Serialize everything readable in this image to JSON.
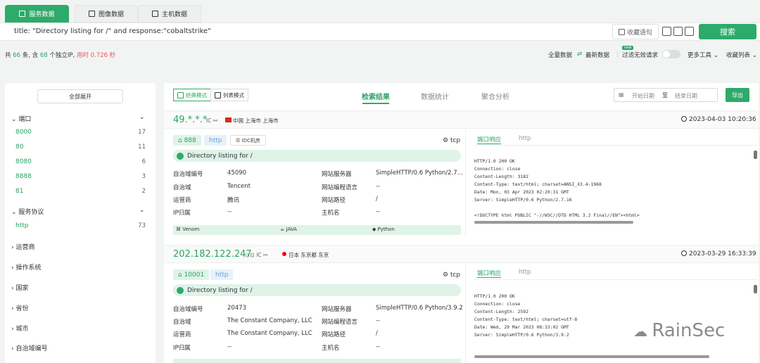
{
  "tabs": [
    {
      "label": "服务数据",
      "active": true
    },
    {
      "label": "图像数据",
      "active": false
    },
    {
      "label": "主机数据",
      "active": false
    }
  ],
  "search": {
    "query": "title: \"Directory listing for /\" and response:\"cobaltstrike\"",
    "collect_label": "收藏语句",
    "button_label": "搜索"
  },
  "stats": {
    "prefix": "共",
    "count": "66",
    "mid1": "条, 含",
    "ip_count": "68",
    "mid2": "个独立IP,",
    "time_label": "用时",
    "time": "0.726 秒"
  },
  "topright": {
    "all_data": "全量数据",
    "latest": "最新数据",
    "new_badge": "new",
    "filter": "过滤无效请求",
    "more_tools": "更多工具",
    "collect_list": "收藏列表"
  },
  "sidebar": {
    "expand_all": "全部展开",
    "groups": [
      {
        "label": "端口",
        "items": [
          {
            "name": "8000",
            "count": "17"
          },
          {
            "name": "80",
            "count": "11"
          },
          {
            "name": "8080",
            "count": "6"
          },
          {
            "name": "8888",
            "count": "3"
          },
          {
            "name": "81",
            "count": "2"
          }
        ]
      },
      {
        "label": "服务协议",
        "items": [
          {
            "name": "http",
            "count": "73"
          }
        ]
      },
      {
        "label": "运营商"
      },
      {
        "label": "操作系统"
      },
      {
        "label": "国家"
      },
      {
        "label": "省份"
      },
      {
        "label": "城市"
      },
      {
        "label": "自治域编号"
      }
    ]
  },
  "main": {
    "modes": [
      "经典模式",
      "列表模式"
    ],
    "tabs": [
      "检索结果",
      "数据统计",
      "聚合分析"
    ],
    "start_date": "开始日期",
    "date_sep": "至",
    "end_date": "结束日期",
    "export": "导出"
  },
  "results": [
    {
      "ip": "49.*.*.*",
      "meta": "IC ⚯",
      "location": "中国 上海市 上海市",
      "timestamp": "2023-04-03 10:20:36",
      "port": "888",
      "proto": "http",
      "extra_tag": "IDC机房",
      "transport": "tcp",
      "title": "Directory listing for /",
      "fields": [
        [
          "自治域编号",
          "45090",
          "网站服务器",
          "SimpleHTTP/0.6 Python/2.7..."
        ],
        [
          "自治域",
          "Tencent",
          "网站编程语言",
          "--"
        ],
        [
          "运营商",
          "腾讯",
          "网站路径",
          "/"
        ],
        [
          "IP归属",
          "--",
          "主机名",
          "--"
        ]
      ],
      "tech": [
        "Venom",
        "JAVA",
        "Python"
      ],
      "rtabs": [
        "端口响应",
        "http"
      ],
      "response": [
        "HTTP/1.0 200 OK",
        "Connection: close",
        "Content-Length: 3182",
        "Content-Type: text/html; charset=ANSI_X3.4-1968",
        "Date: Mon, 03 Apr 2023 02:20:31 GMT",
        "Server: SimpleHTTP/0.6 Python/2.7.16",
        "",
        "<!DOCTYPE html PUBLIC \"-//W3C//DTD HTML 3.2 Final//EN\"><html>"
      ]
    },
    {
      "ip": "202.182.122.247",
      "meta": "IC ⚯",
      "location": "日本 东京都 东京",
      "timestamp": "2023-03-29 16:33:39",
      "port": "10001",
      "proto": "http",
      "transport": "tcp",
      "title": "Directory listing for /",
      "fields": [
        [
          "自治域编号",
          "20473",
          "网站服务器",
          "SimpleHTTP/0.6 Python/3.9.2"
        ],
        [
          "自治域",
          "The Constant Company, LLC",
          "网站编程语言",
          "--"
        ],
        [
          "运营商",
          "The Constant Company, LLC",
          "网站路径",
          "/"
        ],
        [
          "IP归属",
          "--",
          "主机名",
          "--"
        ]
      ],
      "rtabs": [
        "端口响应",
        "http"
      ],
      "response": [
        "HTTP/1.0 200 OK",
        "Connection: close",
        "Content-Length: 2592",
        "Content-Type: text/html; charset=utf-8",
        "Date: Wed, 29 Mar 2023 08:33:02 GMT",
        "Server: SimpleHTTP/0.6 Python/3.9.2"
      ]
    }
  ],
  "watermark": "RainSec"
}
